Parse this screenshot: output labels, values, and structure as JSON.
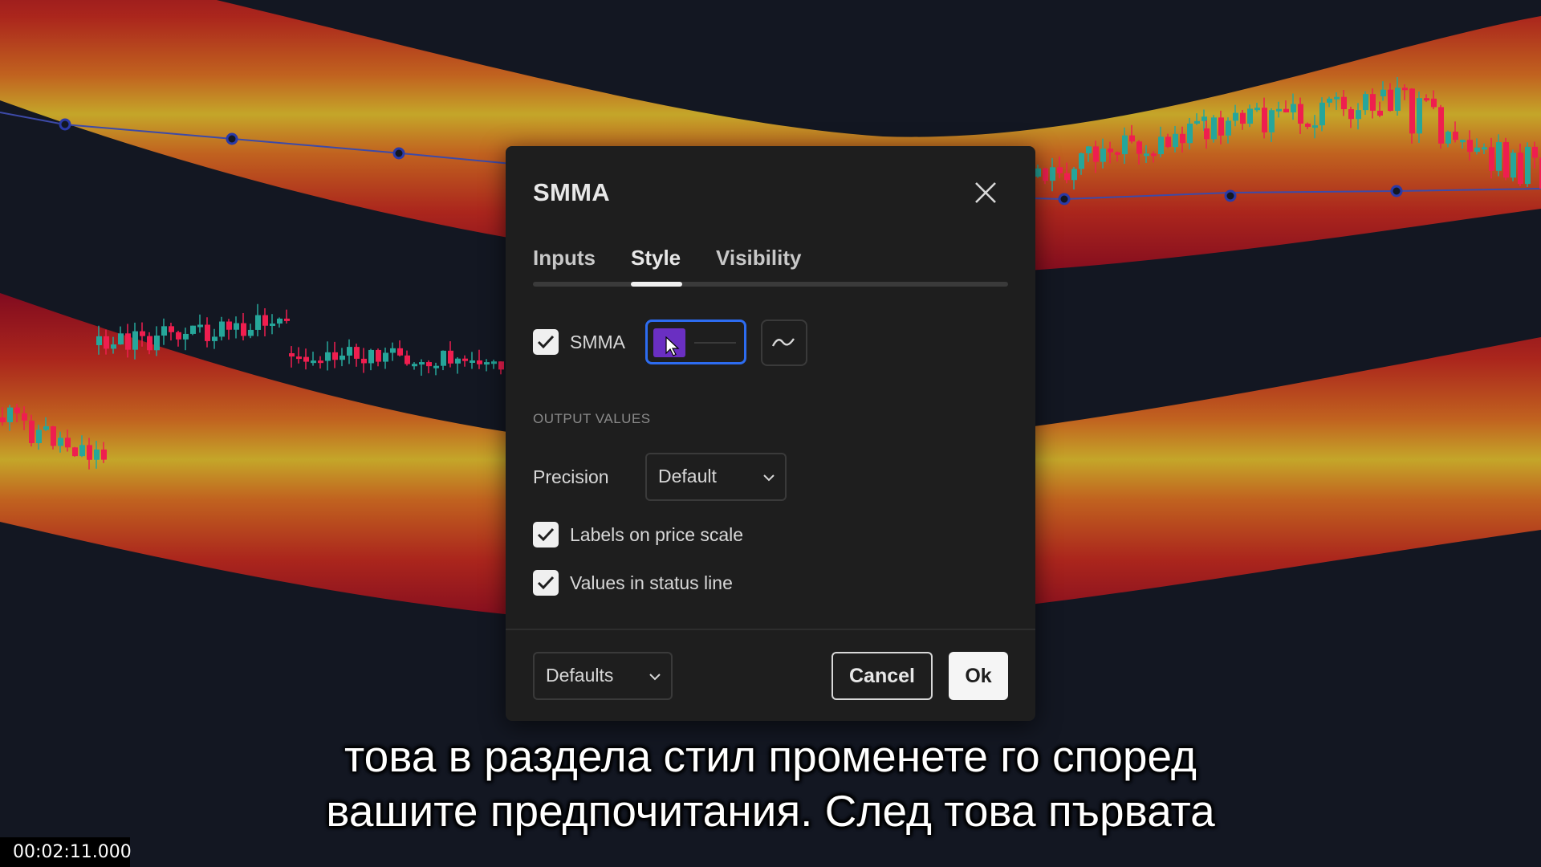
{
  "dialog": {
    "title": "SMMA",
    "tabs": [
      {
        "label": "Inputs",
        "active": false
      },
      {
        "label": "Style",
        "active": true
      },
      {
        "label": "Visibility",
        "active": false
      }
    ],
    "plot": {
      "label": "SMMA",
      "checked": true,
      "color": "#6a2fc2"
    },
    "output_values_label": "OUTPUT VALUES",
    "precision": {
      "label": "Precision",
      "value": "Default"
    },
    "labels_on_price_scale": {
      "label": "Labels on price scale",
      "checked": true
    },
    "values_in_status_line": {
      "label": "Values in status line",
      "checked": true
    },
    "footer": {
      "defaults_label": "Defaults",
      "cancel_label": "Cancel",
      "ok_label": "Ok"
    }
  },
  "subtitles": {
    "line1": "това в раздела стил променете го според",
    "line2": "вашите предпочитания. След това първата"
  },
  "timestamp": "00:02:11.000",
  "colors": {
    "background": "#131722",
    "band_outer": "#8b0a1f",
    "band_inner": "#d4b22a",
    "candle_up": "#26a69a",
    "candle_down": "#ef1e4f",
    "line": "#3d4aa8"
  }
}
